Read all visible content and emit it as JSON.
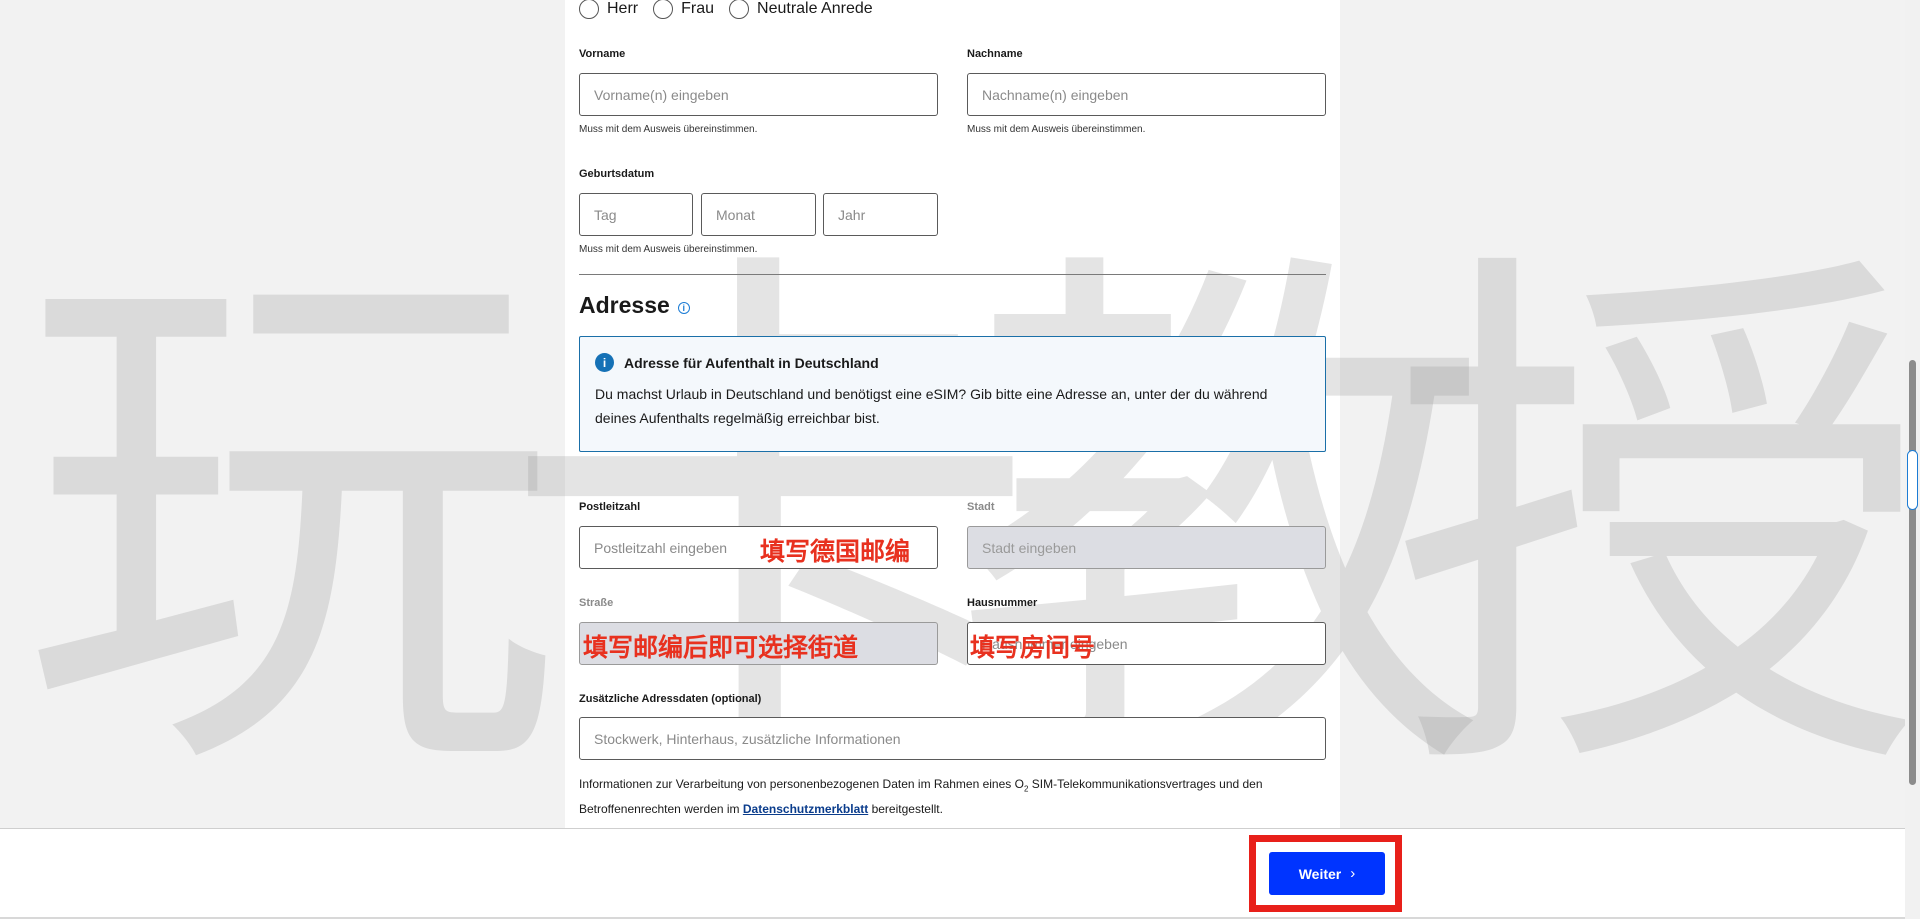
{
  "form": {
    "salutation": {
      "options": [
        "Herr",
        "Frau",
        "Neutrale Anrede"
      ]
    },
    "vorname": {
      "label": "Vorname",
      "placeholder": "Vorname(n) eingeben",
      "hint": "Muss mit dem Ausweis übereinstimmen."
    },
    "nachname": {
      "label": "Nachname",
      "placeholder": "Nachname(n) eingeben",
      "hint": "Muss mit dem Ausweis übereinstimmen."
    },
    "geburtsdatum": {
      "label": "Geburtsdatum",
      "tag": "Tag",
      "monat": "Monat",
      "jahr": "Jahr",
      "hint": "Muss mit dem Ausweis übereinstimmen."
    }
  },
  "address": {
    "title": "Adresse",
    "info": {
      "heading": "Adresse für Aufenthalt in Deutschland",
      "text": "Du machst Urlaub in Deutschland und benötigst eine eSIM? Gib bitte eine Adresse an, unter der du während deines Aufenthalts regelmäßig erreichbar bist."
    },
    "plz": {
      "label": "Postleitzahl",
      "placeholder": "Postleitzahl eingeben"
    },
    "stadt": {
      "label": "Stadt",
      "placeholder": "Stadt eingeben"
    },
    "strasse": {
      "label": "Straße",
      "placeholder": ""
    },
    "hausnummer": {
      "label": "Hausnummer",
      "placeholder": "Hausnummer eingeben"
    },
    "zusatz": {
      "label": "Zusätzliche Adressdaten (optional)",
      "placeholder": "Stockwerk, Hinterhaus, zusätzliche Informationen"
    }
  },
  "annotations": {
    "plz": "填写德国邮编",
    "strasse": "填写邮编后即可选择街道",
    "hausnummer": "填写房间号"
  },
  "watermark": [
    "玩",
    "卡",
    "教",
    "授"
  ],
  "legal": {
    "text1": "Informationen zur Verarbeitung von personenbezogenen Daten im Rahmen eines O",
    "sub": "2",
    "text2": " SIM-Telekommunikationsvertrages und den Betroffenenrechten werden im ",
    "link": "Datenschutzmerkblatt",
    "text3": " bereitgestellt."
  },
  "footer": {
    "next_label": "Weiter",
    "next_icon": "chevron-right-icon"
  },
  "colors": {
    "primary": "#0034ff",
    "annotation": "#e8311f",
    "info": "#1571b6"
  }
}
